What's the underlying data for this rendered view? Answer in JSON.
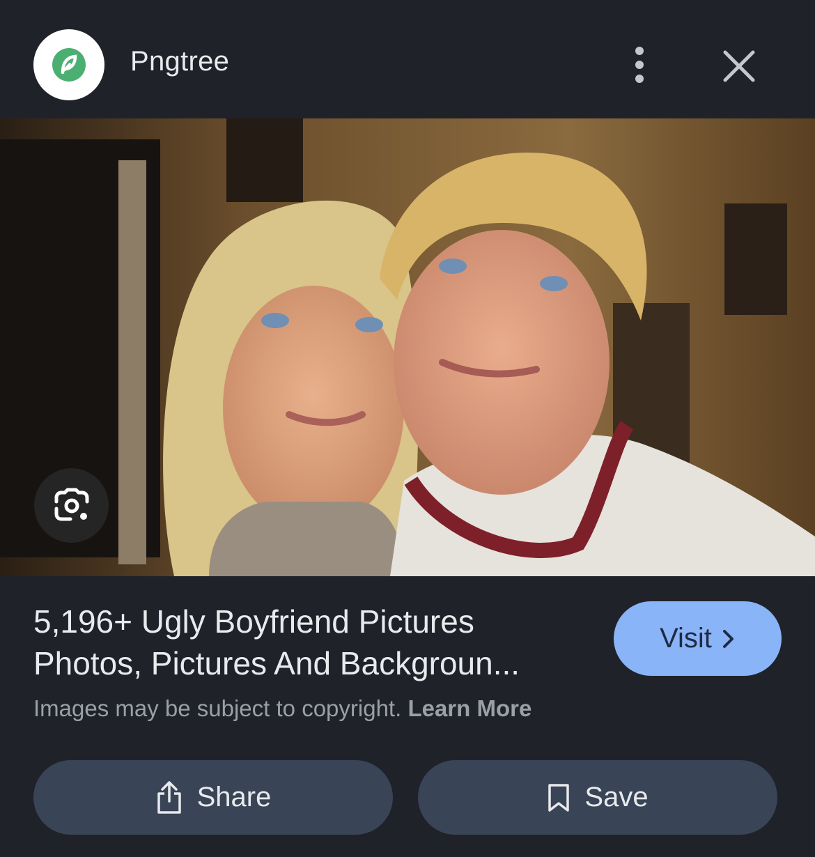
{
  "header": {
    "source_name": "Pngtree",
    "logo_color": "#4caf72"
  },
  "image": {
    "icons": [
      "google-lens-icon"
    ]
  },
  "result": {
    "title_line1": "5,196+ Ugly Boyfriend Pictures",
    "title_line2": "Photos, Pictures And Backgroun...",
    "visit_label": "Visit",
    "copyright_text": "Images may be subject to copyright.",
    "learn_more_label": "Learn More"
  },
  "actions": {
    "share_label": "Share",
    "save_label": "Save"
  },
  "colors": {
    "background": "#202229",
    "visit_button": "#8ab4f8",
    "action_button": "#394457"
  }
}
